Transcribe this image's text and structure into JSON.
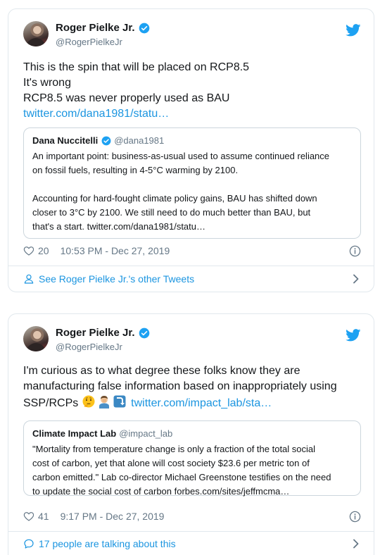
{
  "tweets": [
    {
      "author": {
        "name": "Roger Pielke Jr.",
        "handle": "@RogerPielkeJr"
      },
      "text_lines": [
        "This is the spin that will be placed on RCP8.5",
        "It's wrong",
        "RCP8.5 was never properly used as BAU"
      ],
      "link": "twitter.com/dana1981/statu…",
      "quote": {
        "name": "Dana Nuccitelli",
        "handle": "@dana1981",
        "lines": [
          "An important point: business-as-usual used to assume continued reliance",
          "on fossil fuels, resulting in 4-5°C warming by 2100.",
          "Accounting for hard-fought climate policy gains, BAU has shifted down",
          "closer to 3°C by 2100. We still need to do much better than BAU, but",
          "that's a start. twitter.com/dana1981/statu…"
        ]
      },
      "likes": "20",
      "timestamp": "10:53 PM - Dec 27, 2019",
      "footer": "See Roger Pielke Jr.'s other Tweets"
    },
    {
      "author": {
        "name": "Roger Pielke Jr.",
        "handle": "@RogerPielkeJr"
      },
      "text_lines": [
        "I'm curious as to what degree these folks know they are",
        "manufacturing false information based on inappropriately using",
        "SSP/RCPs"
      ],
      "emojis": [
        "thinking-face-emoji",
        "man-facepalming-emoji",
        "right-arrow-curving-down-emoji"
      ],
      "link": "twitter.com/impact_lab/sta…",
      "quote": {
        "name": "Climate Impact Lab",
        "handle": "@impact_lab",
        "lines": [
          "\"Mortality from temperature change is only a fraction of the total social",
          "cost of carbon, yet that alone will cost society $23.6 per metric ton of",
          "carbon emitted.\" Lab co-director Michael Greenstone testifies on the need",
          "to update the social cost of carbon forbes.com/sites/jeffmcma…"
        ]
      },
      "likes": "41",
      "timestamp": "9:17 PM - Dec 27, 2019",
      "footer": "17 people are talking about this"
    }
  ],
  "colors": {
    "link": "#1b95e0",
    "muted": "#657786",
    "border": "#e1e8ed",
    "text": "#14171a"
  }
}
